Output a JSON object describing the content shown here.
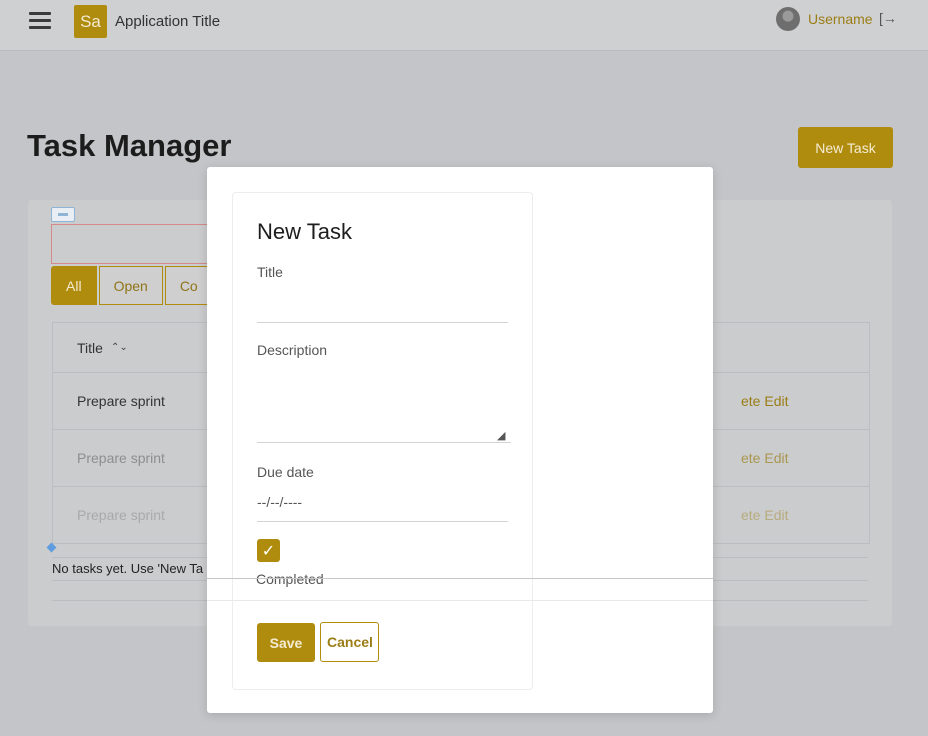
{
  "header": {
    "menu_icon": "hamburger-icon",
    "logo_text": "Sa",
    "app_title": "Application Title",
    "username": "Username",
    "logout_icon": "logout-icon",
    "logout_glyph": "[→"
  },
  "page": {
    "title": "Task Manager",
    "new_task_label": "New Task"
  },
  "filters": [
    {
      "label": "All",
      "active": true
    },
    {
      "label": "Open",
      "active": false
    },
    {
      "label": "Co",
      "active": false
    }
  ],
  "table": {
    "columns": [
      {
        "label": "Title",
        "sort_icon": "sort-icon",
        "sort_glyph": "⌃⌄"
      }
    ],
    "rows": [
      {
        "title": "Prepare sprint",
        "actions": "ete Edit"
      },
      {
        "title": "Prepare sprint",
        "actions": "ete Edit"
      },
      {
        "title": "Prepare sprint",
        "actions": "ete Edit"
      }
    ],
    "empty_message": "No tasks yet. Use 'New Ta"
  },
  "modal": {
    "title": "New Task",
    "title_label": "Title",
    "title_value": "",
    "description_label": "Description",
    "description_value": "",
    "due_label": "Due date",
    "due_placeholder": "--/--/----",
    "completed_label": "Completed",
    "completed_checked": true,
    "save_label": "Save",
    "cancel_label": "Cancel"
  },
  "colors": {
    "accent": "#b08c0e",
    "accent_text": "#9b7d16"
  }
}
